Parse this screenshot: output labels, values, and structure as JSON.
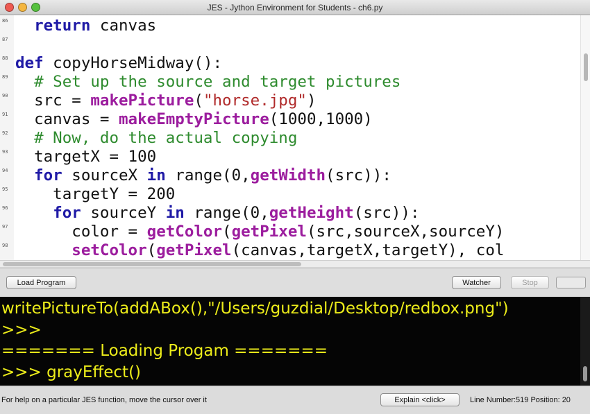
{
  "window": {
    "title": "JES - Jython Environment for Students - ch6.py",
    "traffic_light_colors": [
      "#ee5a52",
      "#f4b63f",
      "#56c13e"
    ]
  },
  "editor": {
    "line_numbers": [
      "86",
      "87",
      "88",
      "89",
      "90",
      "91",
      "92",
      "93",
      "94",
      "95",
      "96",
      "97",
      "98"
    ],
    "code_colors": {
      "keyword": "#1f1aa6",
      "builtin_function": "#9c1d9e",
      "comment": "#2e8b2e",
      "string": "#b02a2a"
    },
    "lines": [
      {
        "tokens": [
          {
            "t": "  "
          },
          {
            "t": "return",
            "c": "kw"
          },
          {
            "t": " canvas"
          }
        ]
      },
      {
        "tokens": [
          {
            "t": ""
          }
        ]
      },
      {
        "tokens": [
          {
            "t": "def",
            "c": "kw"
          },
          {
            "t": " copyHorseMidway():"
          }
        ]
      },
      {
        "tokens": [
          {
            "t": "  "
          },
          {
            "t": "# Set up the source and target pictures",
            "c": "cm"
          }
        ]
      },
      {
        "tokens": [
          {
            "t": "  src = "
          },
          {
            "t": "makePicture",
            "c": "fn"
          },
          {
            "t": "("
          },
          {
            "t": "\"horse.jpg\"",
            "c": "st"
          },
          {
            "t": ")"
          }
        ]
      },
      {
        "tokens": [
          {
            "t": "  canvas = "
          },
          {
            "t": "makeEmptyPicture",
            "c": "fn"
          },
          {
            "t": "(1000,1000)"
          }
        ]
      },
      {
        "tokens": [
          {
            "t": "  "
          },
          {
            "t": "# Now, do the actual copying",
            "c": "cm"
          }
        ]
      },
      {
        "tokens": [
          {
            "t": "  targetX = 100"
          }
        ]
      },
      {
        "tokens": [
          {
            "t": "  "
          },
          {
            "t": "for",
            "c": "kw"
          },
          {
            "t": " sourceX "
          },
          {
            "t": "in",
            "c": "kw"
          },
          {
            "t": " range(0,"
          },
          {
            "t": "getWidth",
            "c": "fn"
          },
          {
            "t": "(src)):"
          }
        ]
      },
      {
        "tokens": [
          {
            "t": "    targetY = 200"
          }
        ]
      },
      {
        "tokens": [
          {
            "t": "    "
          },
          {
            "t": "for",
            "c": "kw"
          },
          {
            "t": " sourceY "
          },
          {
            "t": "in",
            "c": "kw"
          },
          {
            "t": " range(0,"
          },
          {
            "t": "getHeight",
            "c": "fn"
          },
          {
            "t": "(src)):"
          }
        ]
      },
      {
        "tokens": [
          {
            "t": "      color = "
          },
          {
            "t": "getColor",
            "c": "fn"
          },
          {
            "t": "("
          },
          {
            "t": "getPixel",
            "c": "fn"
          },
          {
            "t": "(src,sourceX,sourceY)"
          }
        ]
      },
      {
        "tokens": [
          {
            "t": "      "
          },
          {
            "t": "setColor",
            "c": "fn"
          },
          {
            "t": "("
          },
          {
            "t": "getPixel",
            "c": "fn"
          },
          {
            "t": "(canvas,targetX,targetY), col"
          }
        ]
      }
    ]
  },
  "buttons": {
    "load_program": "Load Program",
    "watcher": "Watcher",
    "stop": "Stop"
  },
  "console": {
    "text_color": "#ecec1a",
    "lines": [
      "writePictureTo(addABox(),\"/Users/guzdial/Desktop/redbox.png\")",
      ">>>",
      "======= Loading Progam =======",
      ">>> grayEffect()"
    ]
  },
  "status": {
    "help_text": "For help on a particular JES function, move the cursor over it",
    "explain_label": "Explain <click>",
    "line_position": "Line Number:519 Position: 20"
  }
}
